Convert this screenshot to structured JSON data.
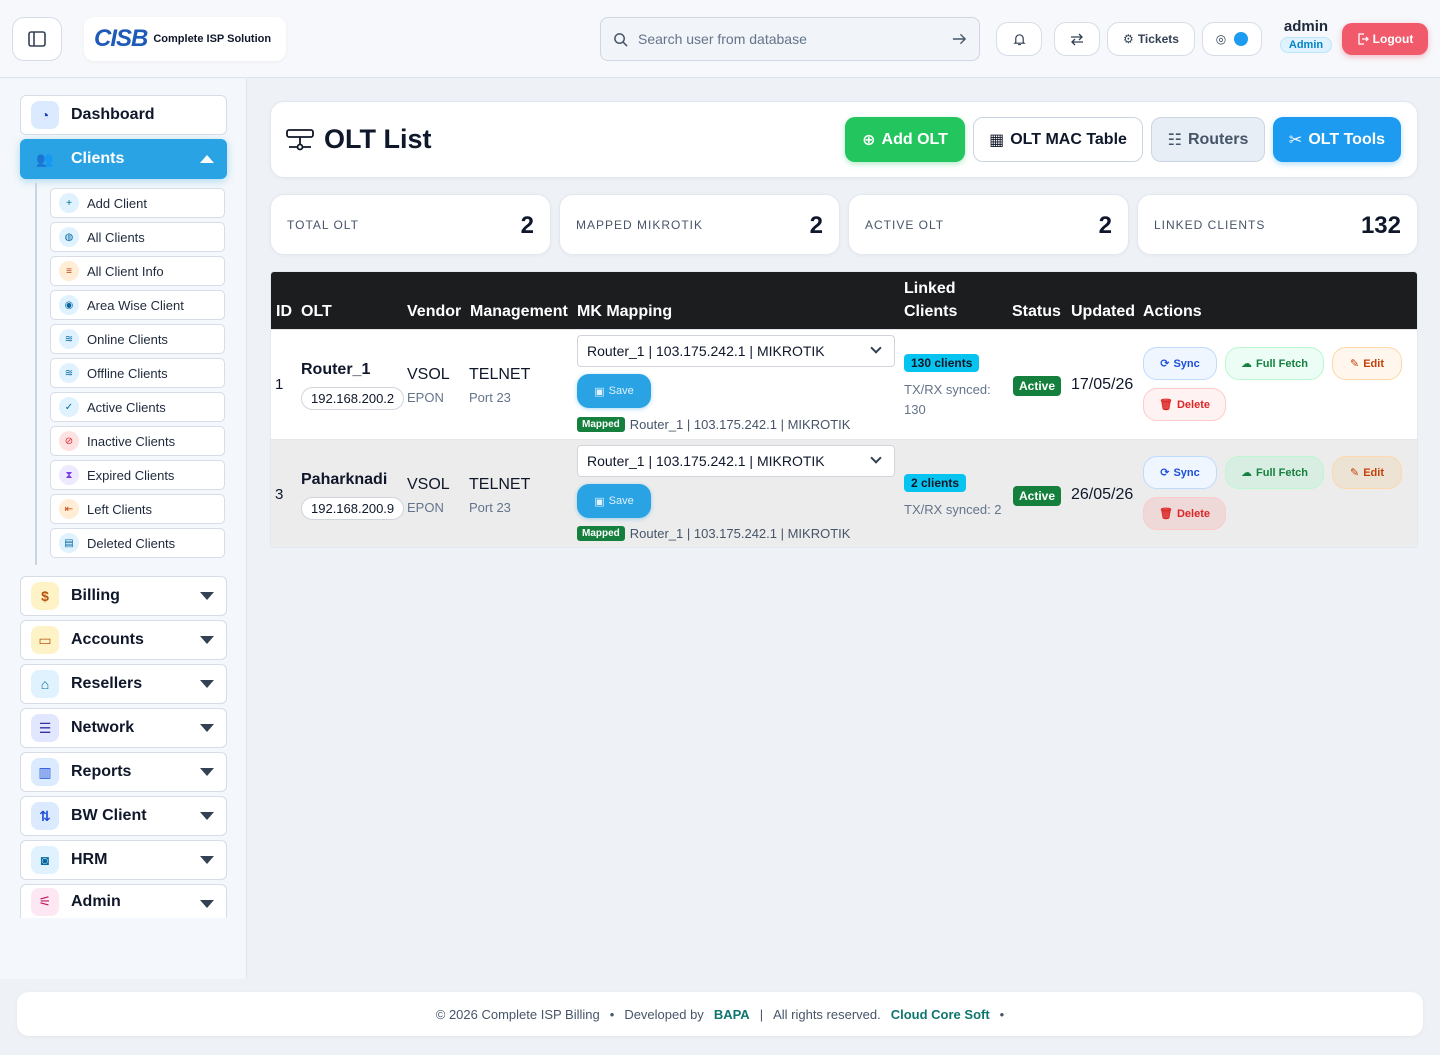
{
  "header": {
    "logo_mark": "CISB",
    "logo_text": "Complete ISP Solution",
    "search_placeholder": "Search user from database",
    "tickets_label": "Tickets",
    "user_name": "admin",
    "user_role": "Admin",
    "logout_label": "Logout"
  },
  "sidebar": {
    "dashboard": "Dashboard",
    "clients": "Clients",
    "sub_items": [
      "Add Client",
      "All Clients",
      "All Client Info",
      "Area Wise Client",
      "Online Clients",
      "Offline Clients",
      "Active Clients",
      "Inactive Clients",
      "Expired Clients",
      "Left Clients",
      "Deleted Clients"
    ],
    "sections": [
      "Billing",
      "Accounts",
      "Resellers",
      "Network",
      "Reports",
      "BW Client",
      "HRM",
      "Admin"
    ]
  },
  "page": {
    "title": "OLT List",
    "add_olt": "Add OLT",
    "mac_table": "OLT MAC Table",
    "routers": "Routers",
    "olt_tools": "OLT Tools"
  },
  "stats": [
    {
      "label": "TOTAL OLT",
      "value": "2"
    },
    {
      "label": "MAPPED MIKROTIK",
      "value": "2"
    },
    {
      "label": "ACTIVE OLT",
      "value": "2"
    },
    {
      "label": "LINKED CLIENTS",
      "value": "132"
    }
  ],
  "table": {
    "headers": {
      "id": "ID",
      "olt": "OLT",
      "vendor": "Vendor",
      "management": "Management",
      "mk_mapping": "MK Mapping",
      "linked_1": "Linked",
      "linked_2": "Clients",
      "status": "Status",
      "updated": "Updated",
      "actions": "Actions"
    },
    "rows": [
      {
        "id": "1",
        "name": "Router_1",
        "ip": "192.168.200.2",
        "vendor": "VSOL",
        "vendor_type": "EPON",
        "mgmt": "TELNET",
        "port": "Port 23",
        "mapping": "Router_1 | 103.175.242.1 | MIKROTIK",
        "save": "Save",
        "mapped_tag": "Mapped",
        "mapped_text": "Router_1 | 103.175.242.1 | MIKROTIK",
        "clients": "130 clients",
        "synced_1": "TX/RX synced:",
        "synced_2": "130",
        "status": "Active",
        "updated": "17/05/26"
      },
      {
        "id": "3",
        "name": "Paharknadi",
        "ip": "192.168.200.9",
        "vendor": "VSOL",
        "vendor_type": "EPON",
        "mgmt": "TELNET",
        "port": "Port 23",
        "mapping": "Router_1 | 103.175.242.1 | MIKROTIK",
        "save": "Save",
        "mapped_tag": "Mapped",
        "mapped_text": "Router_1 | 103.175.242.1 | MIKROTIK",
        "clients": "2 clients",
        "synced_1": "TX/RX synced: 2",
        "synced_2": "",
        "status": "Active",
        "updated": "26/05/26"
      }
    ],
    "actions": {
      "sync": "Sync",
      "fetch": "Full Fetch",
      "edit": "Edit",
      "delete": "Delete"
    }
  },
  "footer": {
    "copyright": "© 2026 Complete ISP Billing",
    "developed_by": "Developed by",
    "dev": "BAPA",
    "rights": "All rights reserved.",
    "company": "Cloud Core Soft"
  }
}
